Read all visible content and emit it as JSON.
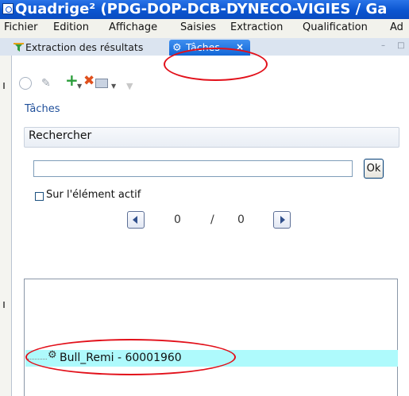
{
  "window": {
    "title": "Quadrige² (PDG-DOP-DCB-DYNECO-VIGIES / Ga"
  },
  "menubar": {
    "items": [
      "Fichier",
      "Edition",
      "Affichage",
      "Saisies",
      "Extraction",
      "Qualification",
      "Ad"
    ]
  },
  "tabs": {
    "items": [
      {
        "label": "Extraction des résultats",
        "icon": "filter-icon",
        "active": false
      },
      {
        "label": "Tâches",
        "icon": "gear-icon",
        "active": true,
        "close": "×"
      }
    ],
    "view_controls": "– □"
  },
  "toolbar": {
    "buttons": [
      "sync-icon",
      "edit-icon",
      "add-icon",
      "delete-icon",
      "move-icon",
      "down-arrow-icon"
    ]
  },
  "view": {
    "title": "Tâches"
  },
  "search": {
    "section_label": "Rechercher",
    "input_value": "",
    "ok_label": "Ok",
    "checkbox_label": "Sur l'élément actif",
    "checkbox_checked": false,
    "page_current": "0",
    "page_separator": "/",
    "page_total": "0"
  },
  "results": {
    "items": [
      {
        "label": "Bull_Remi - 60001960",
        "icon": "gear-icon",
        "selected": true
      }
    ]
  },
  "colors": {
    "title_bar": "#0b55d0",
    "active_tab": "#1b74e0",
    "selected_row": "#aefafc",
    "annotation_ellipse": "#e2101a"
  }
}
